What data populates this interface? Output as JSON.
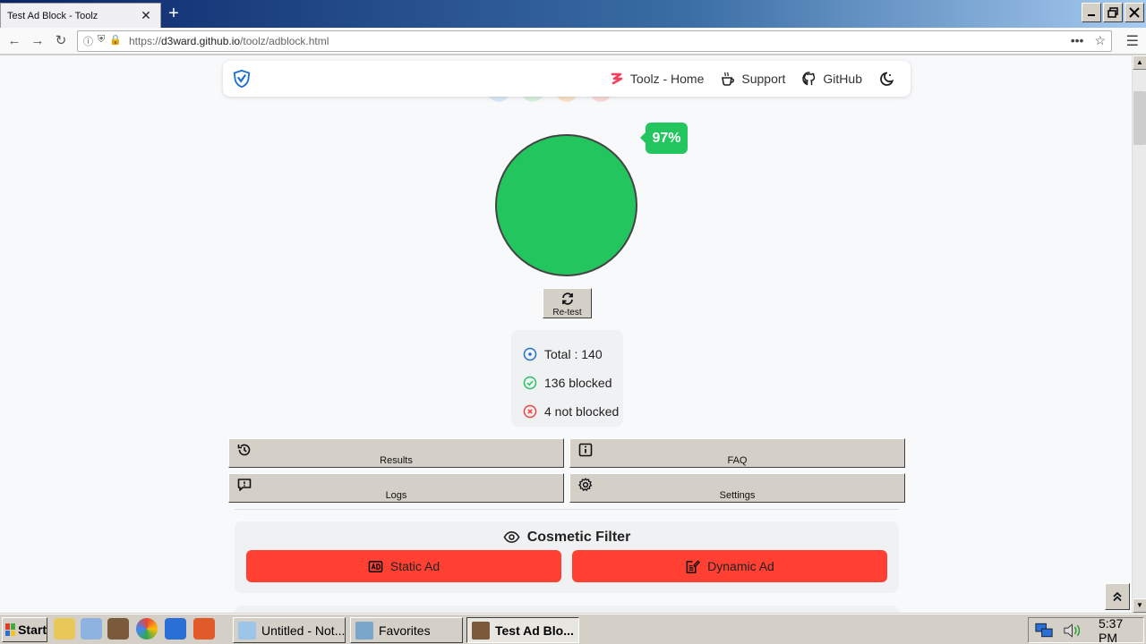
{
  "browser": {
    "tab_title": "Test Ad Block - Toolz",
    "tab_close": "✕",
    "new_tab": "+",
    "url_scheme": "https://",
    "url_host": "d3ward.github.io",
    "url_path": "/toolz/adblock.html",
    "url_more": "•••",
    "window_buttons": [
      "minimize",
      "restore",
      "close"
    ]
  },
  "page": {
    "nav": {
      "links": [
        {
          "label": "Toolz - Home",
          "icon": "toolz-icon"
        },
        {
          "label": "Support",
          "icon": "coffee-icon"
        },
        {
          "label": "GitHub",
          "icon": "github-icon"
        }
      ],
      "theme_icon": "moon-icon"
    },
    "score": {
      "percent_label": "97%",
      "percent": 97,
      "color": "#22c55e"
    },
    "retest_label": "Re-test",
    "stats": {
      "total": "Total : 140",
      "blocked": "136 blocked",
      "not_blocked": "4 not blocked"
    },
    "buttons": {
      "results": "Results",
      "faq": "FAQ",
      "logs": "Logs",
      "settings": "Settings"
    },
    "cosmetic": {
      "title": "Cosmetic Filter",
      "static_ad": "Static Ad",
      "dynamic_ad": "Dynamic Ad",
      "button_color": "#ff4033"
    }
  },
  "taskbar": {
    "start_label": "Start",
    "tasks": [
      {
        "label": "Untitled - Not...",
        "active": false
      },
      {
        "label": "Favorites",
        "active": false
      },
      {
        "label": "Test Ad Blo...",
        "active": true
      }
    ],
    "clock": "5:37 PM"
  }
}
